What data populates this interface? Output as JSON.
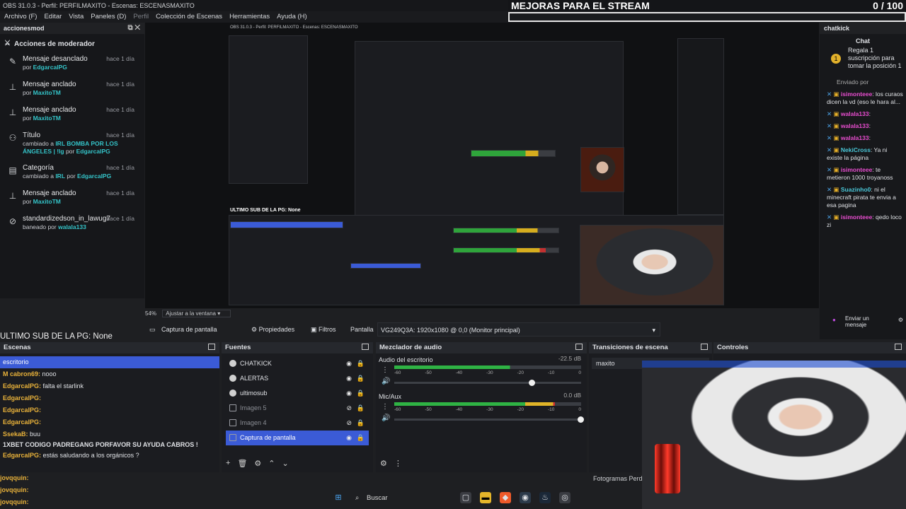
{
  "app": {
    "title": "OBS 31.0.3 - Perfil: PERFILMAXITO - Escenas: ESCENASMAXITO",
    "menu": [
      "Archivo (F)",
      "Editar",
      "Vista",
      "Paneles (D)",
      "Perfil",
      "Colección de Escenas",
      "Herramientas",
      "Ayuda (H)"
    ]
  },
  "stream_overlay": {
    "title": "MEJORAS PARA EL STREAM",
    "count": "0  / 100"
  },
  "mod_dock": {
    "title": "accionesmod",
    "section": "Acciones de moderador",
    "actions": [
      {
        "title": "Mensaje desanclado",
        "time": "hace 1 día",
        "prefix": "por ",
        "user": "EdgarcalPG",
        "icon": "unpin-icon"
      },
      {
        "title": "Mensaje anclado",
        "time": "hace 1 día",
        "prefix": "por ",
        "user": "MaxitoTM",
        "icon": "pin-icon"
      },
      {
        "title": "Mensaje anclado",
        "time": "hace 1 día",
        "prefix": "por ",
        "user": "MaxitoTM",
        "icon": "pin-icon"
      },
      {
        "title": "Título",
        "time": "hace 1 día",
        "prefix": "cambiado a ",
        "detail": "IRL BOMBA POR LOS ÁNGELES | !lg",
        "suffix": " por ",
        "user": "EdgarcalPG",
        "icon": "users-icon"
      },
      {
        "title": "Categoría",
        "time": "hace 1 día",
        "prefix": "cambiado a ",
        "detail": "IRL",
        "suffix": " por ",
        "user": "EdgarcalPG",
        "icon": "category-icon"
      },
      {
        "title": "Mensaje anclado",
        "time": "hace 1 día",
        "prefix": "por ",
        "user": "MaxitoTM",
        "icon": "pin-icon"
      },
      {
        "title": "standardizedson_in_lawug7",
        "time": "hace 1 día",
        "prefix": "baneado por ",
        "user": "walala133",
        "icon": "ban-icon"
      }
    ]
  },
  "preview": {
    "zoom": "54%",
    "fit": "Ajustar a la ventana",
    "inner_title": "OBS 31.0.3 - Perfil: PERFILMAXITO - Escenas: ESCENASMAXITO",
    "inner_ultimo": "ULTIMO SUB DE LA PG: None"
  },
  "source_toolbar": {
    "source": "Captura de pantalla",
    "properties": "Propiedades",
    "filters": "Filtros",
    "display_label": "Pantalla",
    "display_value": "VG249Q3A: 1920x1080 @ 0,0 (Monitor principal)"
  },
  "ultimo_sub": "ULTIMO SUB DE LA PG: None",
  "scenes": {
    "title": "Escenas",
    "lines": [
      {
        "user": "",
        "text": "escritorio",
        "selected": true
      },
      {
        "user": "M cabron69:",
        "text": " nooo"
      },
      {
        "user": "EdgarcalPG:",
        "text": " falta el starlink"
      },
      {
        "user": "EdgarcalPG:",
        "text": ""
      },
      {
        "user": "EdgarcalPG:",
        "text": ""
      },
      {
        "user": "EdgarcalPG:",
        "text": ""
      },
      {
        "user": "SsekaB:",
        "text": " buu"
      },
      {
        "user": "",
        "text": "1XBET CODIGO PADREGANG PORFAVOR SU AYUDA CABROS !"
      },
      {
        "user": "EdgarcalPG:",
        "text": " estás saludando a los orgánicos ?"
      }
    ]
  },
  "viewers": [
    "jovqquin:",
    "jovqquin:",
    "jovqquin:"
  ],
  "sources": {
    "title": "Fuentes",
    "items": [
      {
        "name": "CHATKICK",
        "visible": true
      },
      {
        "name": "ALERTAS",
        "visible": true
      },
      {
        "name": "ultimosub",
        "visible": true
      },
      {
        "name": "Imagen 5",
        "visible": false
      },
      {
        "name": "Imagen 4",
        "visible": false
      },
      {
        "name": "Captura de pantalla",
        "visible": true,
        "selected": true
      }
    ]
  },
  "mixer": {
    "title": "Mezclador de audio",
    "channels": [
      {
        "name": "Audio del escritorio",
        "db": "-22.5 dB",
        "level": 0.62,
        "volume": 0.72
      },
      {
        "name": "Mic/Aux",
        "db": "0.0 dB",
        "level": 0.86,
        "volume": 0.98
      }
    ],
    "scale": [
      "-60",
      "-55",
      "-50",
      "-45",
      "-40",
      "-35",
      "-30",
      "-25",
      "-20",
      "-15",
      "-10",
      "-5",
      "0"
    ]
  },
  "transitions": {
    "title": "Transiciones de escena",
    "selected": "maxito"
  },
  "controls": {
    "title": "Controles"
  },
  "fotogramas": "Fotogramas Perd",
  "chat": {
    "dock_title": "chatkick",
    "tab": "Chat",
    "gift": "Regala 1 suscripción para tomar la posición 1",
    "sent_by": "Enviado por",
    "messages": [
      {
        "user": "isimonteee",
        "text": "los curaos dicen la vd (eso le hara al..."
      },
      {
        "user": "walala133",
        "text": ""
      },
      {
        "user": "walala133",
        "text": ""
      },
      {
        "user": "walala133",
        "text": ""
      },
      {
        "user": "NekiCross",
        "text": "Ya ni existe la página"
      },
      {
        "user": "isimonteee",
        "text": "te metieron 1000 troyanoss"
      },
      {
        "user": "Suazinho0",
        "text": "ni el minecraft pirata te envia a esa pagina"
      },
      {
        "user": "isimonteee",
        "text": "qedo loco zi"
      }
    ],
    "send": "Enviar un mensaje"
  },
  "taskbar": {
    "search": "Buscar"
  }
}
